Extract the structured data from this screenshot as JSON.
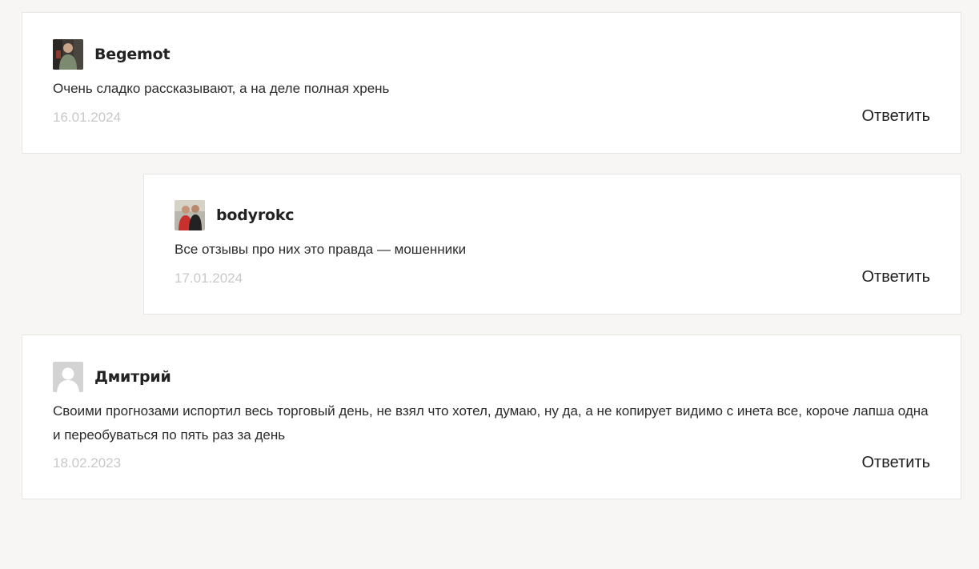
{
  "comments": [
    {
      "author": "Begemot",
      "text": "Очень сладко рассказывают, а на деле полная хрень",
      "date": "16.01.2024",
      "reply_label": "Ответить",
      "avatar": "photo-avatar-icon"
    },
    {
      "author": "bodyrokc",
      "text": "Все отзывы про них это правда — мошенники",
      "date": "17.01.2024",
      "reply_label": "Ответить",
      "avatar": "photo-avatar-icon"
    },
    {
      "author": "Дмитрий",
      "text": "Своими прогнозами испортил весь торговый день, не взял что хотел, думаю, ну да, а не копирует видимо с инета все, короче лапша одна и переобуваться по пять раз за день",
      "date": "18.02.2023",
      "reply_label": "Ответить",
      "avatar": "default-user-avatar-icon"
    }
  ]
}
